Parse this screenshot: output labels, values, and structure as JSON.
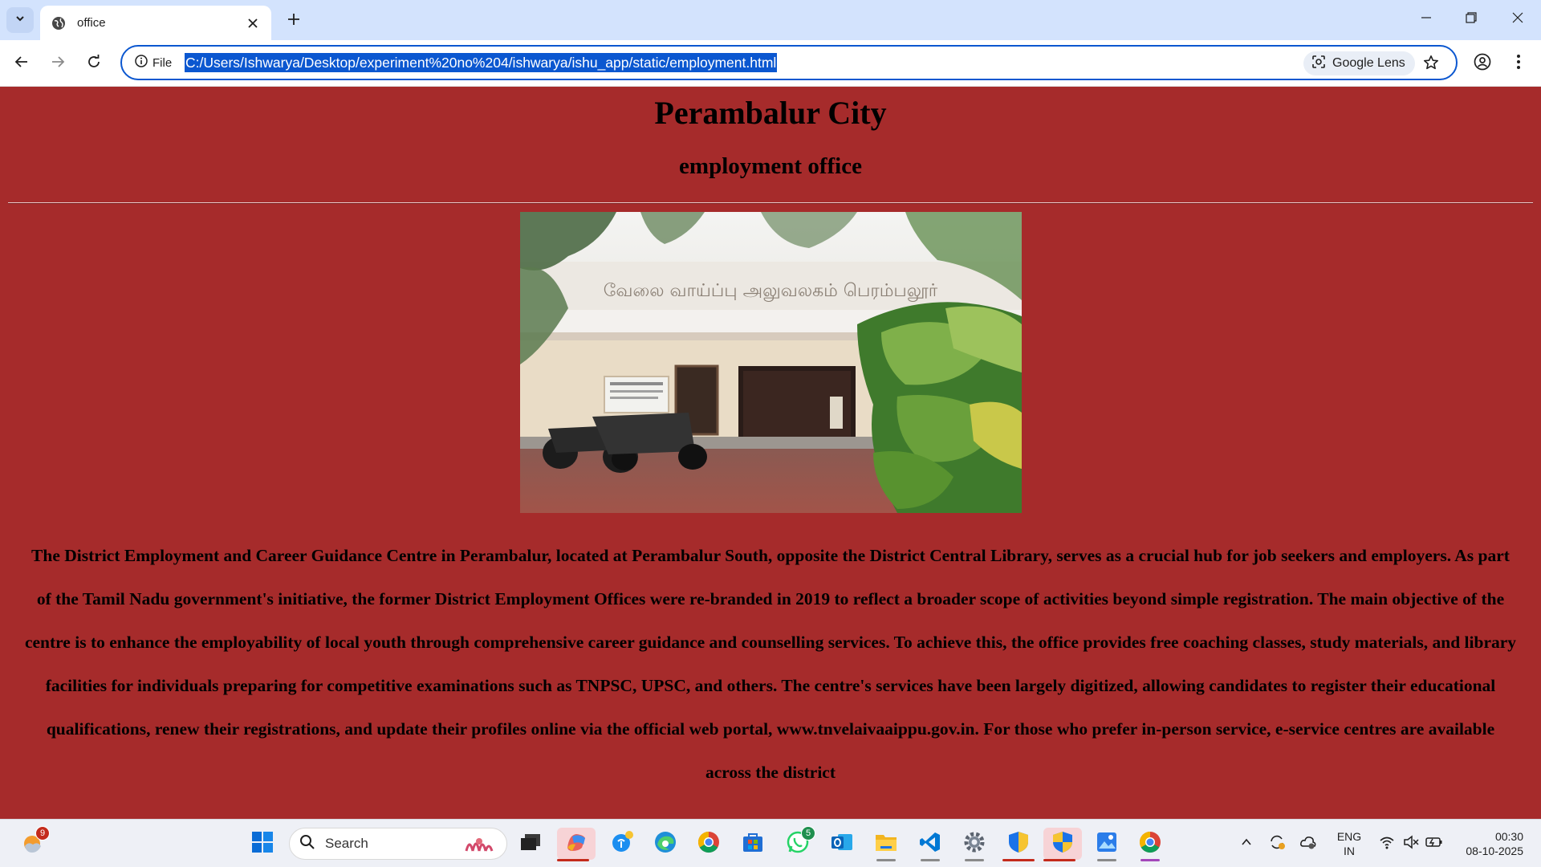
{
  "browser": {
    "tab": {
      "title": "office"
    },
    "omnibox": {
      "site_label": "File",
      "url": "C:/Users/Ishwarya/Desktop/experiment%20no%204/ishwarya/ishu_app/static/employment.html",
      "lens_label": "Google Lens"
    }
  },
  "page": {
    "title": "Perambalur City",
    "subtitle": "employment office",
    "image_sign_text": "வேலை வாய்ப்பு அலுவலகம் பெரம்பலூர்",
    "description": "The District Employment and Career Guidance Centre in Perambalur, located at Perambalur South, opposite the District Central Library, serves as a crucial hub for job seekers and employers. As part of the Tamil Nadu government's initiative, the former District Employment Offices were re-branded in 2019 to reflect a broader scope of activities beyond simple registration. The main objective of the centre is to enhance the employability of local youth through comprehensive career guidance and counselling services. To achieve this, the office provides free coaching classes, study materials, and library facilities for individuals preparing for competitive examinations such as TNPSC, UPSC, and others. The centre's services have been largely digitized, allowing candidates to register their educational qualifications, renew their registrations, and update their profiles online via the official web portal, www.tnvelaivaaippu.gov.in. For those who prefer in-person service, e-service centres are available across the district",
    "background_color": "#a62b2b"
  },
  "taskbar": {
    "weather_badge": "9",
    "search_label": "Search",
    "whatsapp_badge": "5",
    "language": "ENG",
    "region": "IN",
    "time": "00:30",
    "date": "08-10-2025"
  },
  "icons": [
    "tab-search-icon",
    "globe-icon",
    "close-icon",
    "plus-icon",
    "minimize-icon",
    "restore-icon",
    "back-icon",
    "forward-icon",
    "reload-icon",
    "info-icon",
    "lens-icon",
    "star-icon",
    "profile-icon",
    "menu-icon",
    "windows-icon",
    "search-icon",
    "chrome-icon",
    "edge-icon",
    "whatsapp-icon",
    "outlook-icon",
    "folder-icon",
    "vscode-icon",
    "settings-icon",
    "security-icon",
    "wifi-icon",
    "volume-icon",
    "battery-icon"
  ]
}
